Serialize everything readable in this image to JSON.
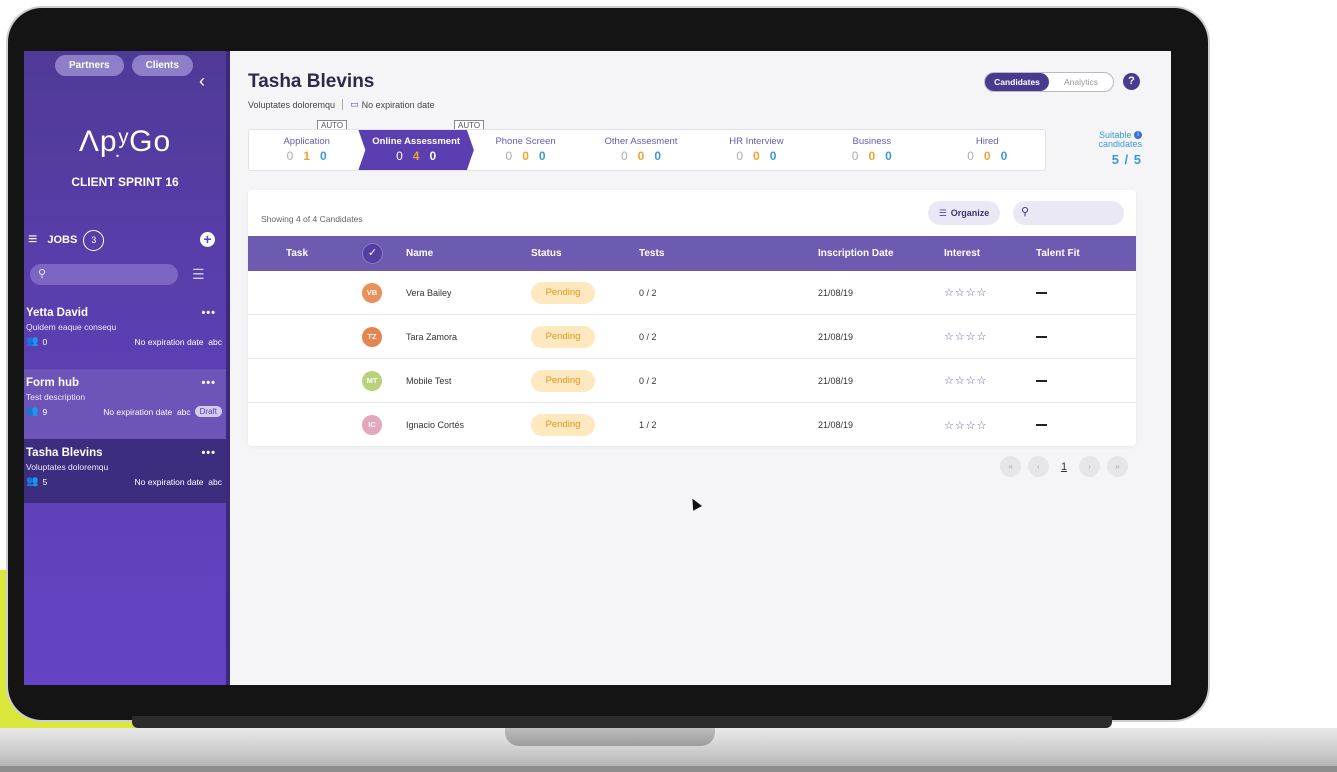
{
  "sidebar": {
    "pills": [
      "Partners",
      "Clients"
    ],
    "collapse_glyph": "‹",
    "logo": "ΛpׅʸGo",
    "sprint": "CLIENT SPRINT 16",
    "jobs_label": "JOBS",
    "jobs_count": "3",
    "jobs": [
      {
        "title": "Yetta David",
        "desc": "Quidem eaque consequ",
        "count": "0",
        "expiry": "No expiration date",
        "tag": "abc",
        "badge": ""
      },
      {
        "title": "Form hub",
        "desc": "Test description",
        "count": "9",
        "expiry": "No expiration date",
        "tag": "abc",
        "badge": "Draft"
      },
      {
        "title": "Tasha Blevins",
        "desc": "Voluptates doloremqu",
        "count": "5",
        "expiry": "No expiration date",
        "tag": "abc",
        "badge": ""
      }
    ]
  },
  "header": {
    "title": "Tasha Blevins",
    "subtitle": "Voluptates doloremqu",
    "expiry": "No expiration date",
    "toggle_active": "Candidates",
    "toggle_inactive": "Analytics",
    "help": "?"
  },
  "pipeline": {
    "auto_label": "AUTO",
    "stages": [
      {
        "name": "Application",
        "a": "0",
        "b": "1",
        "c": "0"
      },
      {
        "name": "Online Assessment",
        "a": "0",
        "b": "4",
        "c": "0"
      },
      {
        "name": "Phone Screen",
        "a": "0",
        "b": "0",
        "c": "0"
      },
      {
        "name": "Other Assesment",
        "a": "0",
        "b": "0",
        "c": "0"
      },
      {
        "name": "HR Interview",
        "a": "0",
        "b": "0",
        "c": "0"
      },
      {
        "name": "Business",
        "a": "0",
        "b": "0",
        "c": "0"
      },
      {
        "name": "Hired",
        "a": "0",
        "b": "0",
        "c": "0"
      }
    ],
    "suitable_label_1": "Suitable",
    "suitable_label_2": "candidates",
    "suitable_value": "5 / 5"
  },
  "table": {
    "showing": "Showing 4 of 4 Candidates",
    "organize": "Organize",
    "headers": {
      "task": "Task",
      "name": "Name",
      "status": "Status",
      "tests": "Tests",
      "date": "Inscription Date",
      "interest": "Interest",
      "fit": "Talent Fit"
    },
    "rows": [
      {
        "initials": "VB",
        "color": "#e8915a",
        "name": "Vera Bailey",
        "status": "Pending",
        "tests": "0 / 2",
        "date": "21/08/19",
        "interest": "☆☆☆☆"
      },
      {
        "initials": "TZ",
        "color": "#e6844f",
        "name": "Tara Zamora",
        "status": "Pending",
        "tests": "0 / 2",
        "date": "21/08/19",
        "interest": "☆☆☆☆"
      },
      {
        "initials": "MT",
        "color": "#b9d27a",
        "name": "Mobile Test",
        "status": "Pending",
        "tests": "0 / 2",
        "date": "21/08/19",
        "interest": "☆☆☆☆"
      },
      {
        "initials": "IC",
        "color": "#e3a6bd",
        "name": "Ignacio Cortés",
        "status": "Pending",
        "tests": "1 / 2",
        "date": "21/08/19",
        "interest": "☆☆☆☆"
      }
    ]
  },
  "pagination": {
    "current": "1"
  },
  "colors": {
    "primary": "#5b3fb1",
    "header_row": "#6c5bb1",
    "pending_bg": "#fde8bf",
    "pending_text": "#e5951a",
    "accent_blue": "#3b9ad6"
  }
}
